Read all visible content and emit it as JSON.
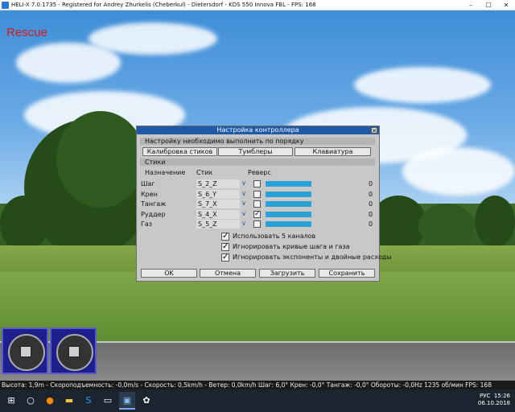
{
  "window": {
    "title": "HELI-X 7.0.1735 - Registered for Andrey Zhurkelis (Cheberkul) - Dietersdorf - KDS 550 Innova FBL - FPS: 168",
    "controls": [
      "–",
      "☐",
      "✕"
    ]
  },
  "hud": {
    "mode": "Rescue"
  },
  "dialog": {
    "title": "Настройка контроллера",
    "close": "✕",
    "section_order": "Настройку необходимо выполнить по порядку",
    "buttons_top": [
      "Калибровка стиков",
      "Тумблеры",
      "Клавиатура"
    ],
    "section_sticks": "Стики",
    "headers": {
      "assignment": "Назначение",
      "stick": "Стик",
      "reverse": "Реверс"
    },
    "rows": [
      {
        "label": "Шаг",
        "stick": "S_2_Z",
        "reverse": false,
        "value": "0",
        "level": 1.0
      },
      {
        "label": "Крен",
        "stick": "S_6_Y",
        "reverse": false,
        "value": "0",
        "level": 1.0
      },
      {
        "label": "Тангаж",
        "stick": "S_7_X",
        "reverse": false,
        "value": "0",
        "level": 1.0
      },
      {
        "label": "Руддер",
        "stick": "S_4_X",
        "reverse": true,
        "value": "0",
        "level": 1.0
      },
      {
        "label": "Газ",
        "stick": "S_5_Z",
        "reverse": false,
        "value": "0",
        "level": 1.0
      }
    ],
    "options": [
      {
        "label": "Использовать 5 каналов",
        "checked": true
      },
      {
        "label": "Игнорировать кривые шага и газа",
        "checked": true
      },
      {
        "label": "Игнорировать экспоненты и двойные расходы",
        "checked": true
      }
    ],
    "buttons_bottom": [
      "OK",
      "Отмена",
      "Загрузить",
      "Сохранить"
    ],
    "colors": {
      "title_bg": "#1f5aa8",
      "bar": "#27a1d6"
    }
  },
  "status_bar": "Высота: 1,9m - Скороподъемность: -0,0m/s - Скорость: 0,5km/h - Ветер: 0,0km/h Шаг: 6,0° Крен: -0,0° Тангаж: -0,0° Обороты: -0,0Hz 1235 об/мин FPS: 168",
  "taskbar": {
    "icons": [
      "windows-logo",
      "search-icon",
      "firefox-icon",
      "file-explorer-icon",
      "skype-icon",
      "terminal-icon",
      "heli-x-icon",
      "app-icon"
    ],
    "tray": {
      "lang": "РУС",
      "time": "15:26",
      "date": "06.10.2018"
    }
  }
}
